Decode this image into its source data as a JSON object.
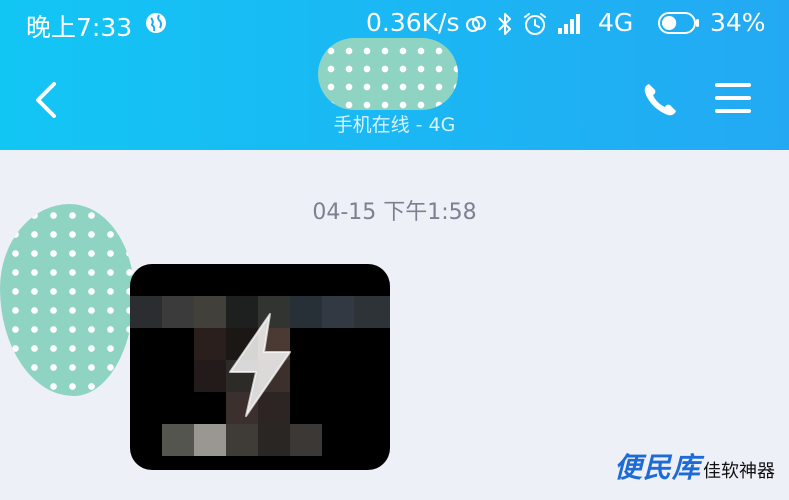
{
  "status_bar": {
    "time": "晚上7:33",
    "net_speed": "0.36K/s",
    "network": "4G",
    "battery_percent": "34%",
    "battery_level": 0.34,
    "icons": [
      "globe-icon",
      "link-icon",
      "bluetooth-icon",
      "alarm-icon",
      "signal-icon",
      "battery-icon"
    ]
  },
  "chat_header": {
    "online_status": "手机在线 - 4G",
    "icons": [
      "back-chevron-icon",
      "phone-icon",
      "menu-icon"
    ]
  },
  "conversation": {
    "timestamp": "04-15 下午1:58"
  },
  "watermark": {
    "brand": "便民库",
    "tagline": "佳软神器"
  },
  "colors": {
    "header_start": "#12c6f4",
    "header_end": "#23a9f3",
    "background": "#eef0f7",
    "watermark_blue": "#1e6bd6"
  }
}
